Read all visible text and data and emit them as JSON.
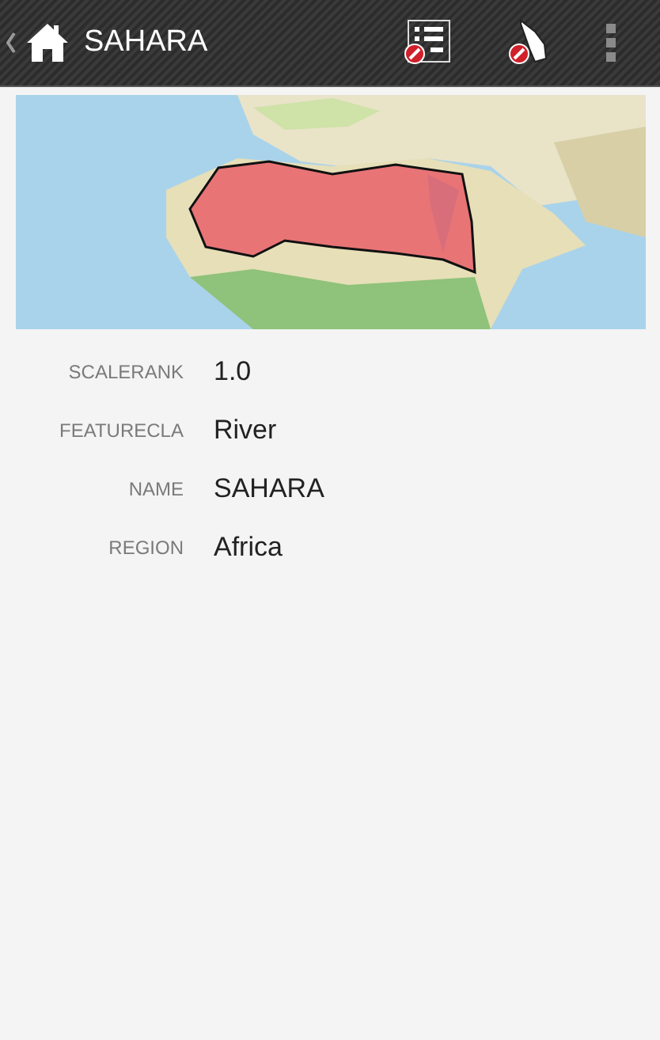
{
  "action_bar": {
    "title": "SAHARA"
  },
  "attributes": [
    {
      "label": "SCALERANK",
      "value": "1.0"
    },
    {
      "label": "FEATURECLA",
      "value": "River"
    },
    {
      "label": "NAME",
      "value": "SAHARA"
    },
    {
      "label": "REGION",
      "value": "Africa"
    }
  ]
}
